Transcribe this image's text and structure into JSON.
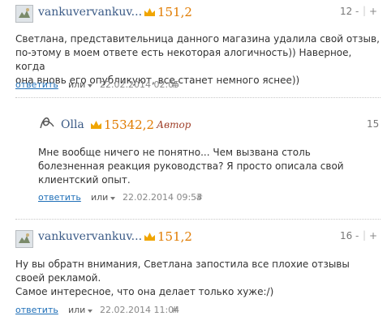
{
  "comments": [
    {
      "author": "vankuvervankuv...",
      "rating": "151,2",
      "score": "12",
      "minus": "-",
      "plus": "+",
      "text": "Светлана, представительница данного магазина удалила свой отзыв,\nпо-этому в моем ответе есть некоторая алогичность)) Наверное, когда\nона вновь его опубликуют, все станет немного яснее))",
      "reply": "ответить",
      "or": "или",
      "date": "22.02.2014 02:05",
      "hash": "#"
    },
    {
      "author": "Olla",
      "rating": "15342,2",
      "role": "Автор",
      "score": "15",
      "text": "Мне вообще ничего не понятно... Чем вызвана столь\nболезненная реакция руководства? Я просто описала свой\nклиентский опыт.",
      "reply": "ответить",
      "or": "или",
      "date": "22.02.2014 09:53",
      "hash": "#"
    },
    {
      "author": "vankuvervankuv...",
      "rating": "151,2",
      "score": "16",
      "minus": "-",
      "plus": "+",
      "text": "Ну вы обратн внимания, Светлана запостила все плохие отзывы\nсвоей рекламой.\nСамое интересное, что она делает только хуже:/)",
      "reply": "ответить",
      "or": "или",
      "date": "22.02.2014 11:04",
      "hash": "#"
    }
  ],
  "colors": {
    "author": "#3a5a86",
    "rating": "#e07b00",
    "crown": "#f0a500",
    "role": "#a0402a",
    "link": "#1f6fb8"
  }
}
